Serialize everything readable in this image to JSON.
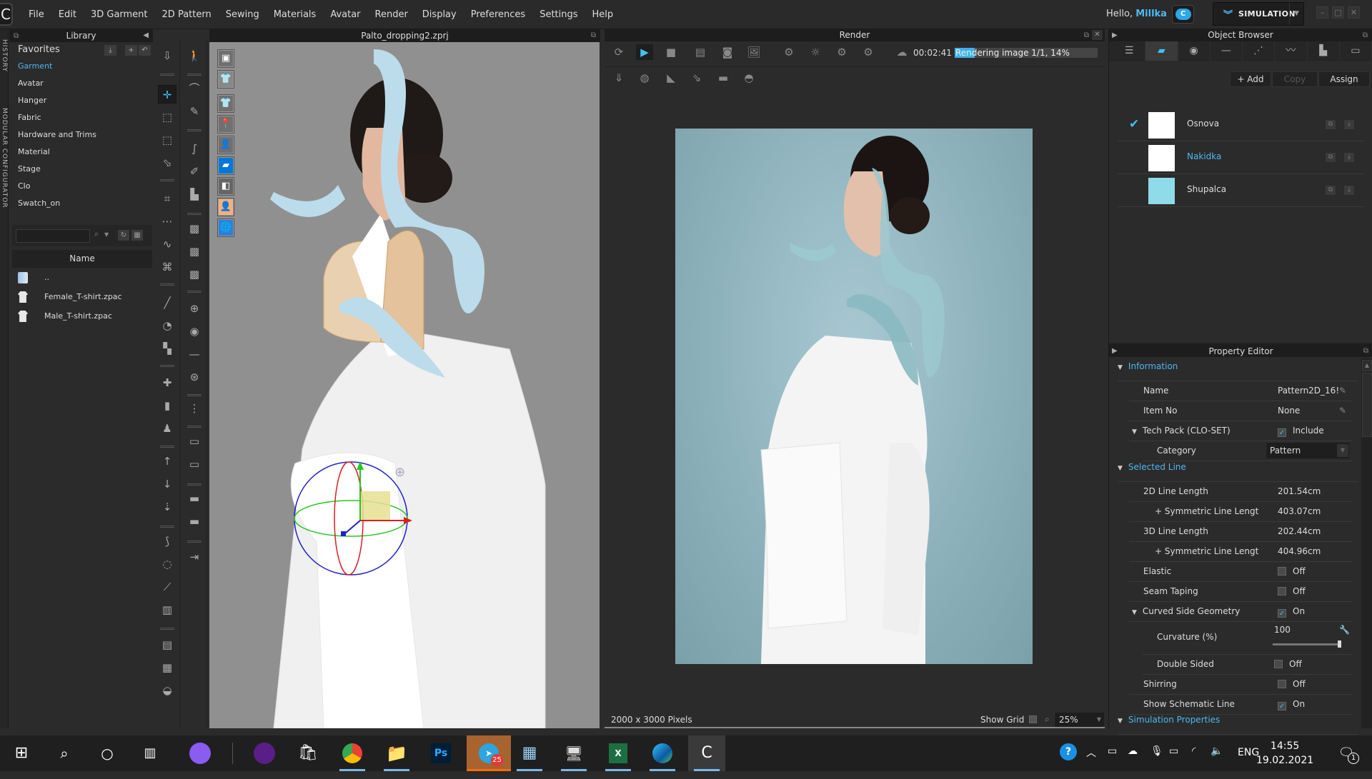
{
  "app": {
    "menu": [
      "File",
      "Edit",
      "3D Garment",
      "2D Pattern",
      "Sewing",
      "Materials",
      "Avatar",
      "Render",
      "Display",
      "Preferences",
      "Settings",
      "Help"
    ],
    "greeting": "Hello,",
    "user": "Millka",
    "mode": "SIMULATION",
    "window_controls": [
      "minimize",
      "maximize",
      "close"
    ]
  },
  "side_tabs": [
    "HISTORY",
    "MODULAR CONFIGURATOR"
  ],
  "library": {
    "title": "Library",
    "favorites_label": "Favorites",
    "items": [
      "Garment",
      "Avatar",
      "Hanger",
      "Fabric",
      "Hardware and Trims",
      "Material",
      "Stage",
      "Clo",
      "Swatch_on"
    ],
    "active_item": "Garment",
    "search_value": "",
    "column_header": "Name",
    "files": [
      "..",
      "Female_T-shirt.zpac",
      "Male_T-shirt.zpac"
    ]
  },
  "viewport": {
    "title": "Palto_dropping2.zprj",
    "display_buttons": [
      "render-shortcut",
      "garment-display",
      "show-garment",
      "show-pins",
      "show-avatar",
      "fabric-texture",
      "shaded",
      "avatar-skin",
      "environment"
    ]
  },
  "render": {
    "title": "Render",
    "elapsed": "00:02:41",
    "status": "Rendering image 1/1, 14%",
    "progress_percent": 14,
    "image_size": "2000 x 3000 Pixels",
    "show_grid_label": "Show Grid",
    "show_grid": false,
    "zoom": "25%"
  },
  "object_browser": {
    "title": "Object Browser",
    "tabs": [
      "list",
      "fabric",
      "button",
      "buttonhole",
      "topstitch",
      "zipper",
      "puckering",
      "trim"
    ],
    "active_tab": "fabric",
    "actions": {
      "add": "+ Add",
      "copy": "Copy",
      "assign": "Assign"
    },
    "fabrics": [
      {
        "name": "Osnova",
        "color": "#ffffff",
        "checked": true,
        "highlight": false
      },
      {
        "name": "Nakidka",
        "color": "#ffffff",
        "checked": false,
        "highlight": true
      },
      {
        "name": "Shupalca",
        "color": "#90dbe9",
        "checked": false,
        "highlight": false
      }
    ]
  },
  "property_editor": {
    "title": "Property Editor",
    "information": {
      "header": "Information",
      "name_label": "Name",
      "name_value": "Pattern2D_16!",
      "itemno_label": "Item No",
      "itemno_value": "None",
      "techpack_label": "Tech Pack (CLO-SET)",
      "techpack_value": "Include",
      "techpack_checked": true,
      "category_label": "Category",
      "category_value": "Pattern"
    },
    "selected_line": {
      "header": "Selected Line",
      "rows": [
        {
          "label": "2D Line Length",
          "value": "201.54cm"
        },
        {
          "label": "+ Symmetric Line Lengt",
          "value": "403.07cm"
        },
        {
          "label": "3D Line Length",
          "value": "202.44cm"
        },
        {
          "label": "+ Symmetric Line Lengt",
          "value": "404.96cm"
        }
      ],
      "elastic_label": "Elastic",
      "elastic_value": "Off",
      "seam_taping_label": "Seam Taping",
      "seam_taping_value": "Off",
      "curved_label": "Curved Side Geometry",
      "curved_value": "On",
      "curvature_label": "Curvature (%)",
      "curvature_value": "100",
      "curvature_fraction": 1.0,
      "double_sided_label": "Double Sided",
      "double_sided_value": "Off",
      "shirring_label": "Shirring",
      "shirring_value": "Off",
      "schematic_label": "Show Schematic Line",
      "schematic_value": "On"
    },
    "simulation_header": "Simulation Properties"
  },
  "taskbar": {
    "apps": [
      "start",
      "search",
      "cortana",
      "task-view",
      "alice",
      "podcast",
      "store",
      "chrome",
      "explorer",
      "photoshop",
      "telegram",
      "calculator",
      "task-monitor",
      "excel",
      "edge",
      "clo"
    ],
    "telegram_badge": "25",
    "language": "ENG",
    "time": "14:55",
    "date": "19.02.2021",
    "notifications": "1"
  }
}
